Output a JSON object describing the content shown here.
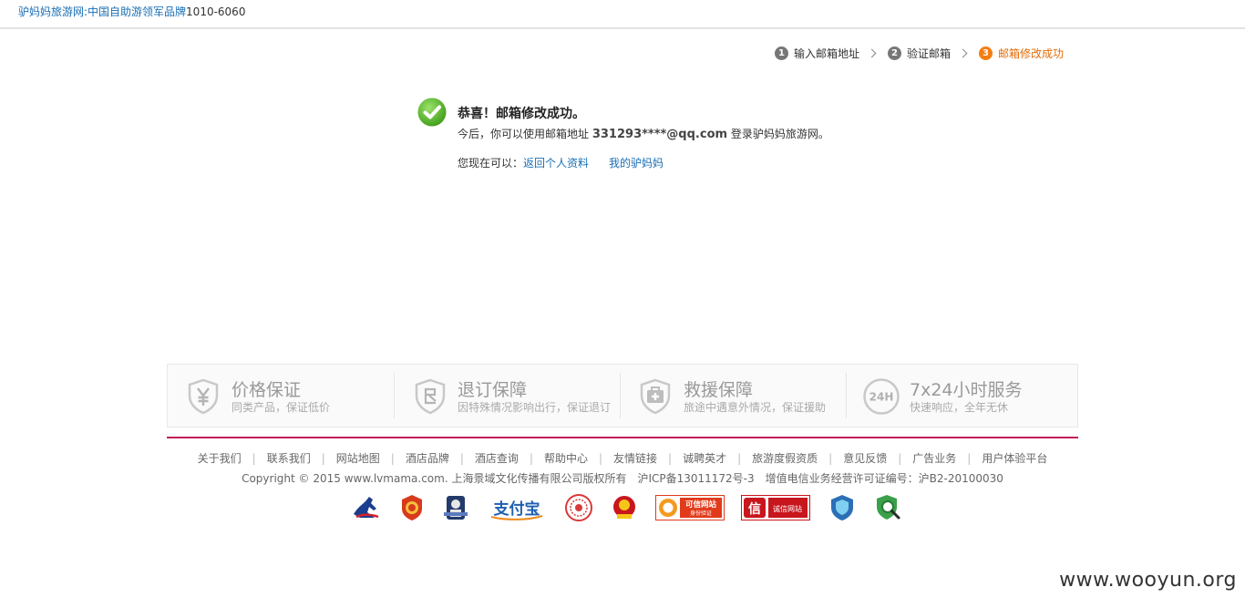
{
  "header": {
    "brand_text": "驴妈妈旅游网:中国自助游领军品牌",
    "phone": "1010-6060"
  },
  "steps": [
    {
      "num": "1",
      "label": "输入邮箱地址"
    },
    {
      "num": "2",
      "label": "验证邮箱"
    },
    {
      "num": "3",
      "label": "邮箱修改成功"
    }
  ],
  "success": {
    "title": "恭喜！邮箱修改成功。",
    "desc_prefix": "今后，你可以使用邮箱地址",
    "email": "331293****@qq.com",
    "desc_suffix": "登录驴妈妈旅游网。",
    "now_can_label": "您现在可以：",
    "link_profile": "返回个人资料",
    "link_my": "我的驴妈妈"
  },
  "guarantees": [
    {
      "title": "价格保证",
      "sub": "同类产品，保证低价",
      "icon": "yen-shield-icon"
    },
    {
      "title": "退订保障",
      "sub": "因特殊情况影响出行，保证退订",
      "icon": "refund-shield-icon"
    },
    {
      "title": "救援保障",
      "sub": "旅途中遇意外情况，保证援助",
      "icon": "firstaid-shield-icon"
    },
    {
      "title": "7x24小时服务",
      "sub": "快速响应，全年无休",
      "icon": "24h-icon",
      "icon_text": "24H"
    }
  ],
  "footer": {
    "links": [
      "关于我们",
      "联系我们",
      "网站地图",
      "酒店品牌",
      "酒店查询",
      "帮助中心",
      "友情链接",
      "诚聘英才",
      "旅游度假资质",
      "意见反馈",
      "广告业务",
      "用户体验平台"
    ],
    "copyright": "Copyright © 2015 www.lvmama.com. 上海景域文化传播有限公司版权所有　沪ICP备13011172号-3　增值电信业务经营许可证编号：沪B2-20100030",
    "badge_alipay": "支付宝",
    "badge_trust": "可信网站",
    "badge_trust_sub": "身份验证",
    "badge_cx": "诚信网站",
    "badge_cx_char": "信"
  },
  "watermark": "www.wooyun.org",
  "colors": {
    "link": "#1a6fb5",
    "active_step": "#e36c09",
    "footer_line": "#c2185b"
  }
}
